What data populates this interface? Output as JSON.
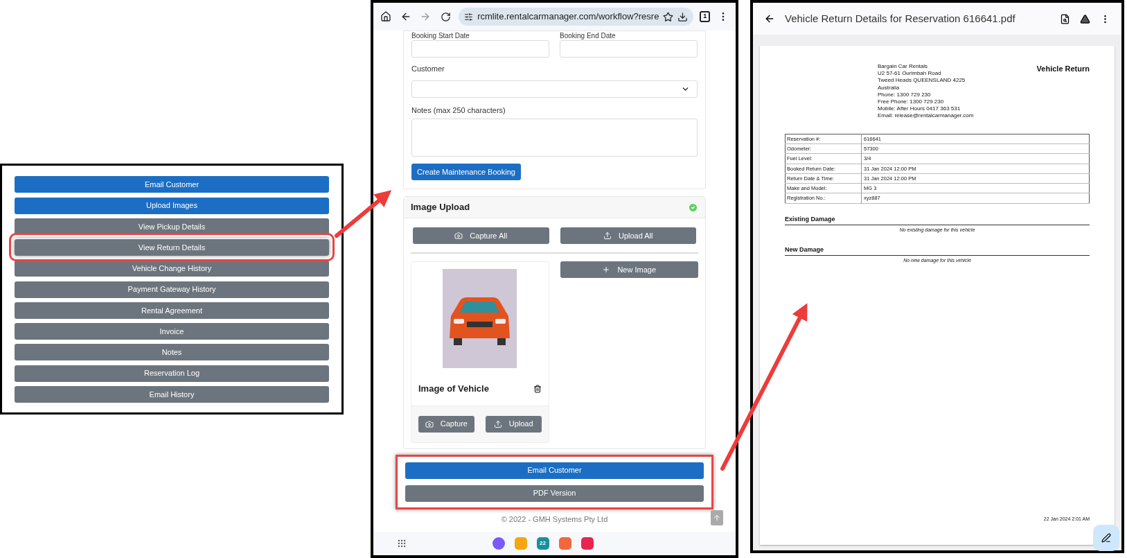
{
  "menu_panel": {
    "buttons": [
      {
        "label": "Email Customer",
        "kind": "primary",
        "highlighted": false
      },
      {
        "label": "Upload Images",
        "kind": "primary",
        "highlighted": false
      },
      {
        "label": "View Pickup Details",
        "kind": "secondary",
        "highlighted": false
      },
      {
        "label": "View Return Details",
        "kind": "secondary",
        "highlighted": true
      },
      {
        "label": "Vehicle Change History",
        "kind": "secondary",
        "highlighted": false
      },
      {
        "label": "Payment Gateway History",
        "kind": "secondary",
        "highlighted": false
      },
      {
        "label": "Rental Agreement",
        "kind": "secondary",
        "highlighted": false
      },
      {
        "label": "Invoice",
        "kind": "secondary",
        "highlighted": false
      },
      {
        "label": "Notes",
        "kind": "secondary",
        "highlighted": false
      },
      {
        "label": "Reservation Log",
        "kind": "secondary",
        "highlighted": false
      },
      {
        "label": "Email History",
        "kind": "secondary",
        "highlighted": false
      }
    ]
  },
  "browser": {
    "url": "rcmlite.rentalcarmanager.com/workflow?resre",
    "tab_count": "1"
  },
  "maintenance_form": {
    "start_label": "Booking Start Date",
    "end_label": "Booking End Date",
    "customer_label": "Customer",
    "notes_label": "Notes (max 250 characters)",
    "submit": "Create Maintenance Booking"
  },
  "image_upload": {
    "title": "Image Upload",
    "complete": true,
    "capture_all": "Capture All",
    "upload_all": "Upload All",
    "new_image": "New Image",
    "images": [
      {
        "title": "Image of Vehicle",
        "capture": "Capture",
        "upload": "Upload"
      }
    ]
  },
  "actions": {
    "highlighted": true,
    "buttons": [
      {
        "label": "Email Customer",
        "kind": "primary"
      },
      {
        "label": "PDF Version",
        "kind": "secondary"
      }
    ]
  },
  "footer": "© 2022 - GMH Systems Pty Ltd",
  "dock": {
    "calendar_day": "22"
  },
  "pdf_viewer": {
    "title": "Vehicle Return Details for Reservation 616641.pdf",
    "company_lines": [
      "Bargain Car Rentals",
      "U2 57-61 Ourimbah Road",
      "Tweed Heads QUEENSLAND 4225",
      "Australia",
      "Phone: 1300 729 230",
      "Free Phone: 1300 729 230",
      "Mobile: After Hours 0417 363 531",
      "Email: release@rentalcarmanager.com"
    ],
    "heading": "Vehicle Return",
    "rows": [
      {
        "label": "Reservation #:",
        "value": "616641"
      },
      {
        "label": "Odometer:",
        "value": "57300"
      },
      {
        "label": "Fuel Level:",
        "value": "3/4"
      },
      {
        "label": "Booked Return Date:",
        "value": "31 Jan 2024 12:00 PM"
      },
      {
        "label": "Return Date & Time:",
        "value": "31 Jan 2024 12:00 PM"
      },
      {
        "label": "Make and Model:",
        "value": "MG 3"
      },
      {
        "label": "Registration No.:",
        "value": "xyz887"
      }
    ],
    "sections": [
      {
        "title": "Existing Damage",
        "note": "No existing damage for this vehicle"
      },
      {
        "title": "New Damage",
        "note": "No new damage for this vehicle"
      }
    ],
    "printed": "22 Jan 2024 2:01 AM"
  }
}
